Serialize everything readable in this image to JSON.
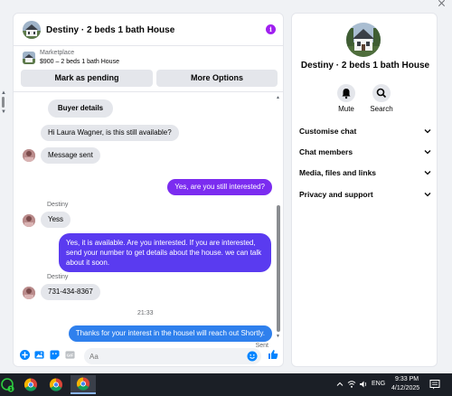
{
  "listing": {
    "title": "Destiny · 2 beds 1 bath House",
    "marketplace_label": "Marketplace",
    "price_line": "$900 – 2 beds 1 bath House"
  },
  "actions": {
    "mark_pending": "Mark as pending",
    "more_options": "More Options"
  },
  "messages": {
    "buyer_details": "Buyer details",
    "auto_question": "Hi Laura Wagner, is this still available?",
    "message_sent": "Message sent",
    "out_1": "Yes, are you still interested?",
    "sender_1": "Destiny",
    "reply_1": "Yess",
    "out_2": "Yes, it is available. Are you interested. If you are interested, send your number to get details about the house. we can talk about it soon.",
    "sender_2": "Destiny",
    "reply_2": "731-434-8367",
    "timestamp": "21:33",
    "out_3": "Thanks for your interest in the housel will reach out Shortly.",
    "status": "Sent"
  },
  "composer": {
    "placeholder": "Aa"
  },
  "details_panel": {
    "title": "Destiny · 2 beds 1 bath House",
    "mute_label": "Mute",
    "search_label": "Search",
    "sections": [
      "Customise chat",
      "Chat members",
      "Media, files and links",
      "Privacy and support"
    ]
  },
  "taskbar": {
    "lang": "ENG",
    "time": "9:33 PM",
    "date": "4/12/2025",
    "chat_badge": "1"
  },
  "colors": {
    "accent_purple": "#7b2cf0",
    "accent_blue": "#2f80ed",
    "messenger_blue": "#0084ff",
    "info_purple": "#a020f0"
  }
}
